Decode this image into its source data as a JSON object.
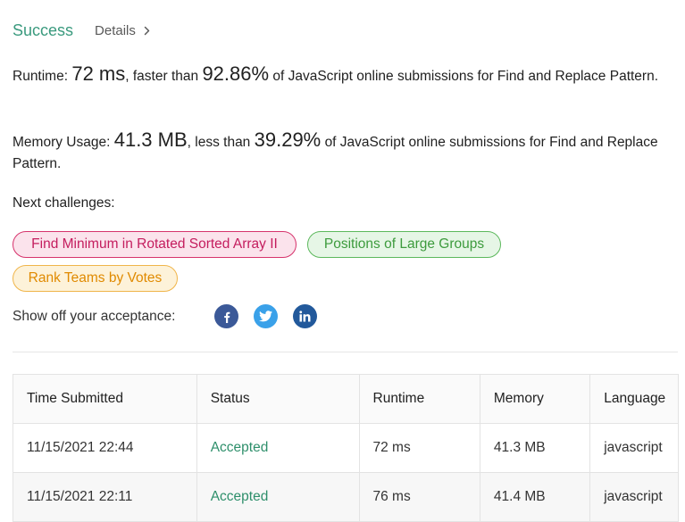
{
  "header": {
    "status": "Success",
    "details_label": "Details"
  },
  "runtime": {
    "label": "Runtime:",
    "value": "72 ms",
    "mid_text": ", faster than",
    "percent": "92.86%",
    "tail_text": "of JavaScript online submissions for Find and Replace Pattern."
  },
  "memory": {
    "label": "Memory Usage:",
    "value": "41.3 MB",
    "mid_text": ", less than",
    "percent": "39.29%",
    "tail_text": "of JavaScript online submissions for Find and Replace Pattern."
  },
  "next_challenges": {
    "label": "Next challenges:",
    "items": [
      {
        "label": "Find Minimum in Rotated Sorted Array II",
        "difficulty": "hard",
        "color": "#c41d5e"
      },
      {
        "label": "Positions of Large Groups",
        "difficulty": "easy",
        "color": "#3d9b3d"
      },
      {
        "label": "Rank Teams by Votes",
        "difficulty": "medium",
        "color": "#e08a00"
      }
    ]
  },
  "share": {
    "label": "Show off your acceptance:",
    "icons": [
      "facebook-icon",
      "twitter-icon",
      "linkedin-icon"
    ]
  },
  "table": {
    "headers": [
      "Time Submitted",
      "Status",
      "Runtime",
      "Memory",
      "Language"
    ],
    "rows": [
      {
        "time": "11/15/2021 22:44",
        "status": "Accepted",
        "runtime": "72 ms",
        "memory": "41.3 MB",
        "language": "javascript"
      },
      {
        "time": "11/15/2021 22:11",
        "status": "Accepted",
        "runtime": "76 ms",
        "memory": "41.4 MB",
        "language": "javascript"
      }
    ]
  },
  "colors": {
    "success": "#3a9a7e",
    "accepted": "#2e8f6b"
  }
}
